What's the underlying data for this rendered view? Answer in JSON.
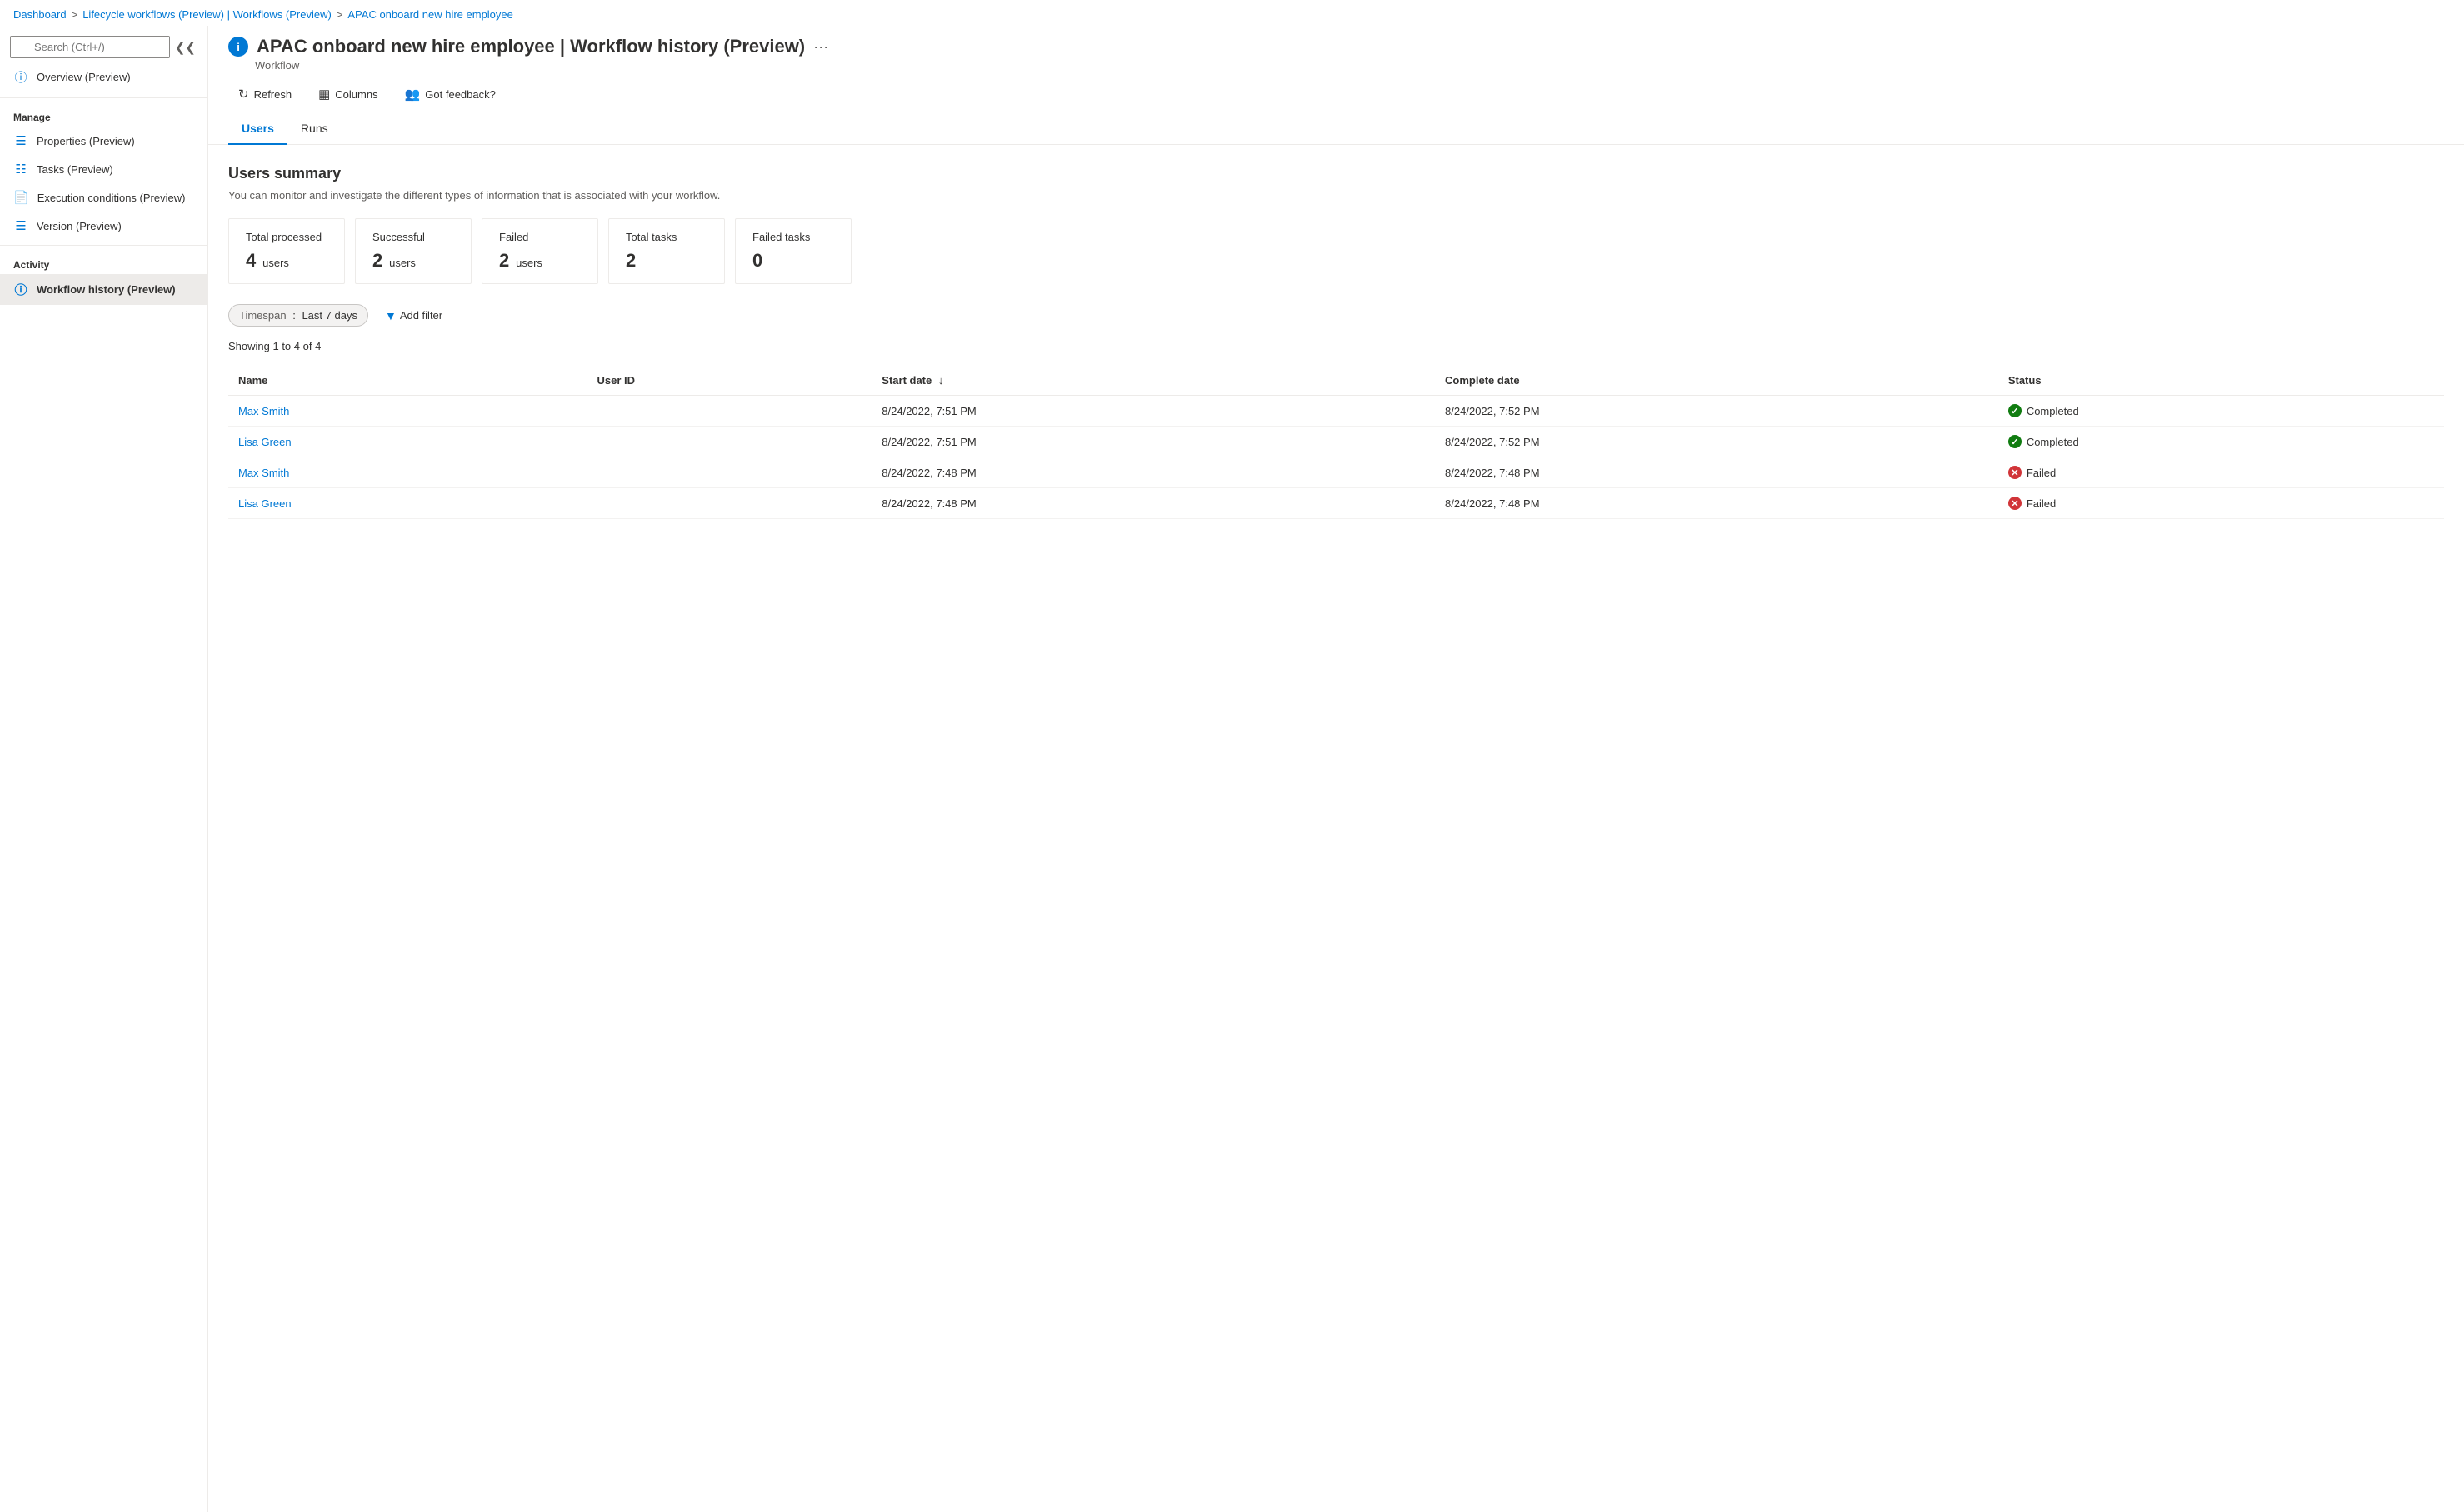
{
  "breadcrumb": {
    "items": [
      {
        "label": "Dashboard",
        "href": "#"
      },
      {
        "label": "Lifecycle workflows (Preview) | Workflows (Preview)",
        "href": "#"
      },
      {
        "label": "APAC onboard new hire employee",
        "href": "#"
      }
    ],
    "separators": [
      ">",
      ">"
    ]
  },
  "page": {
    "icon": "i",
    "title": "APAC onboard new hire employee | Workflow history (Preview)",
    "subtitle": "Workflow",
    "more_label": "···"
  },
  "toolbar": {
    "refresh_label": "Refresh",
    "columns_label": "Columns",
    "feedback_label": "Got feedback?"
  },
  "tabs": [
    {
      "label": "Users",
      "active": true
    },
    {
      "label": "Runs",
      "active": false
    }
  ],
  "users_summary": {
    "title": "Users summary",
    "description": "You can monitor and investigate the different types of information that is associated with your workflow.",
    "cards": [
      {
        "label": "Total processed",
        "value": "4",
        "unit": "users"
      },
      {
        "label": "Successful",
        "value": "2",
        "unit": "users"
      },
      {
        "label": "Failed",
        "value": "2",
        "unit": "users"
      },
      {
        "label": "Total tasks",
        "value": "2",
        "unit": ""
      },
      {
        "label": "Failed tasks",
        "value": "0",
        "unit": ""
      }
    ]
  },
  "filters": {
    "timespan_label": "Timespan",
    "timespan_value": "Last 7 days",
    "add_filter_label": "Add filter"
  },
  "table": {
    "showing_text": "Showing 1 to 4 of 4",
    "columns": [
      {
        "label": "Name",
        "sortable": false
      },
      {
        "label": "User ID",
        "sortable": false
      },
      {
        "label": "Start date",
        "sortable": true,
        "sort_dir": "↓"
      },
      {
        "label": "Complete date",
        "sortable": false
      },
      {
        "label": "Status",
        "sortable": false
      }
    ],
    "rows": [
      {
        "name": "Max Smith",
        "user_id": "",
        "start_date": "8/24/2022, 7:51 PM",
        "complete_date": "8/24/2022, 7:52 PM",
        "status": "Completed",
        "status_type": "completed"
      },
      {
        "name": "Lisa Green",
        "user_id": "",
        "start_date": "8/24/2022, 7:51 PM",
        "complete_date": "8/24/2022, 7:52 PM",
        "status": "Completed",
        "status_type": "completed"
      },
      {
        "name": "Max Smith",
        "user_id": "",
        "start_date": "8/24/2022, 7:48 PM",
        "complete_date": "8/24/2022, 7:48 PM",
        "status": "Failed",
        "status_type": "failed"
      },
      {
        "name": "Lisa Green",
        "user_id": "",
        "start_date": "8/24/2022, 7:48 PM",
        "complete_date": "8/24/2022, 7:48 PM",
        "status": "Failed",
        "status_type": "failed"
      }
    ]
  },
  "sidebar": {
    "search_placeholder": "Search (Ctrl+/)",
    "overview_label": "Overview (Preview)",
    "manage_label": "Manage",
    "manage_items": [
      {
        "label": "Properties (Preview)",
        "icon": "bars"
      },
      {
        "label": "Tasks (Preview)",
        "icon": "list"
      },
      {
        "label": "Execution conditions (Preview)",
        "icon": "doc"
      },
      {
        "label": "Version (Preview)",
        "icon": "layers"
      }
    ],
    "activity_label": "Activity",
    "activity_items": [
      {
        "label": "Workflow history (Preview)",
        "icon": "info",
        "active": true
      }
    ]
  }
}
